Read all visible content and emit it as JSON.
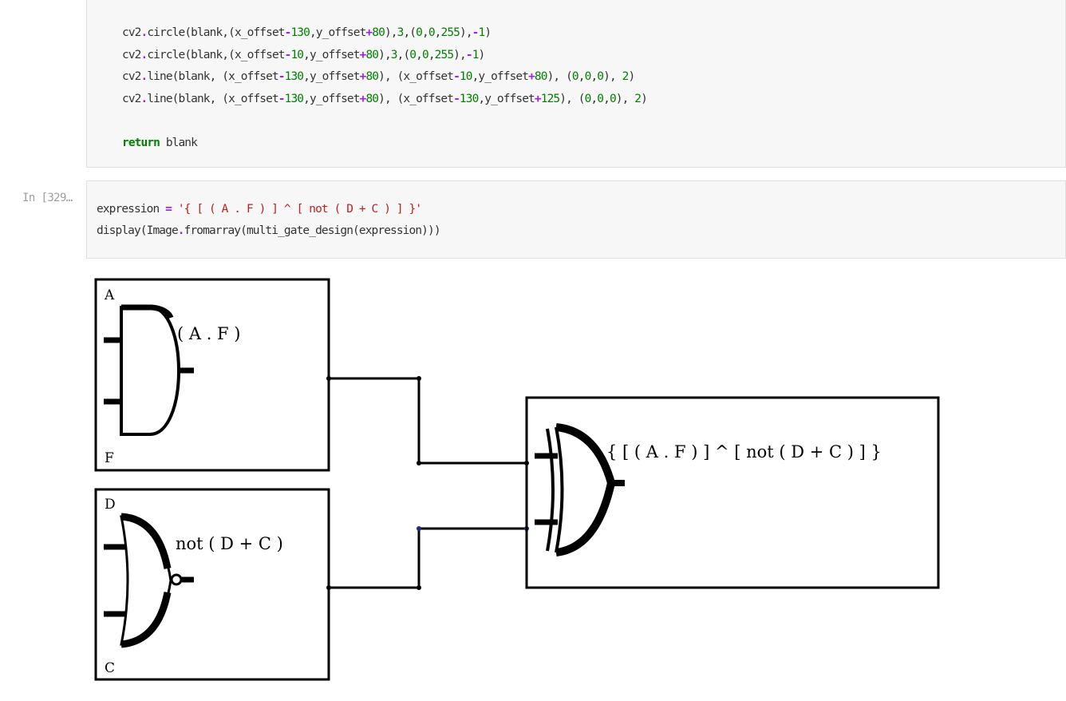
{
  "cell1": {
    "lines": [
      [
        {
          "t": "cv2",
          "c": ""
        },
        {
          "t": ".",
          "c": "o"
        },
        {
          "t": "circle(blank,(x_offset",
          "c": ""
        },
        {
          "t": "-",
          "c": "o"
        },
        {
          "t": "130",
          "c": "n"
        },
        {
          "t": ",y_offset",
          "c": ""
        },
        {
          "t": "+",
          "c": "o"
        },
        {
          "t": "80",
          "c": "n"
        },
        {
          "t": "),",
          "c": ""
        },
        {
          "t": "3",
          "c": "n"
        },
        {
          "t": ",(",
          "c": ""
        },
        {
          "t": "0",
          "c": "n"
        },
        {
          "t": ",",
          "c": ""
        },
        {
          "t": "0",
          "c": "n"
        },
        {
          "t": ",",
          "c": ""
        },
        {
          "t": "255",
          "c": "n"
        },
        {
          "t": "),",
          "c": ""
        },
        {
          "t": "-",
          "c": "o"
        },
        {
          "t": "1",
          "c": "n"
        },
        {
          "t": ")",
          "c": ""
        }
      ],
      [
        {
          "t": "cv2",
          "c": ""
        },
        {
          "t": ".",
          "c": "o"
        },
        {
          "t": "circle(blank,(x_offset",
          "c": ""
        },
        {
          "t": "-",
          "c": "o"
        },
        {
          "t": "10",
          "c": "n"
        },
        {
          "t": ",y_offset",
          "c": ""
        },
        {
          "t": "+",
          "c": "o"
        },
        {
          "t": "80",
          "c": "n"
        },
        {
          "t": "),",
          "c": ""
        },
        {
          "t": "3",
          "c": "n"
        },
        {
          "t": ",(",
          "c": ""
        },
        {
          "t": "0",
          "c": "n"
        },
        {
          "t": ",",
          "c": ""
        },
        {
          "t": "0",
          "c": "n"
        },
        {
          "t": ",",
          "c": ""
        },
        {
          "t": "255",
          "c": "n"
        },
        {
          "t": "),",
          "c": ""
        },
        {
          "t": "-",
          "c": "o"
        },
        {
          "t": "1",
          "c": "n"
        },
        {
          "t": ")",
          "c": ""
        }
      ],
      [
        {
          "t": "cv2",
          "c": ""
        },
        {
          "t": ".",
          "c": "o"
        },
        {
          "t": "line(blank, (x_offset",
          "c": ""
        },
        {
          "t": "-",
          "c": "o"
        },
        {
          "t": "130",
          "c": "n"
        },
        {
          "t": ",y_offset",
          "c": ""
        },
        {
          "t": "+",
          "c": "o"
        },
        {
          "t": "80",
          "c": "n"
        },
        {
          "t": "), (x_offset",
          "c": ""
        },
        {
          "t": "-",
          "c": "o"
        },
        {
          "t": "10",
          "c": "n"
        },
        {
          "t": ",y_offset",
          "c": ""
        },
        {
          "t": "+",
          "c": "o"
        },
        {
          "t": "80",
          "c": "n"
        },
        {
          "t": "), (",
          "c": ""
        },
        {
          "t": "0",
          "c": "n"
        },
        {
          "t": ",",
          "c": ""
        },
        {
          "t": "0",
          "c": "n"
        },
        {
          "t": ",",
          "c": ""
        },
        {
          "t": "0",
          "c": "n"
        },
        {
          "t": "), ",
          "c": ""
        },
        {
          "t": "2",
          "c": "n"
        },
        {
          "t": ")",
          "c": ""
        }
      ],
      [
        {
          "t": "cv2",
          "c": ""
        },
        {
          "t": ".",
          "c": "o"
        },
        {
          "t": "line(blank, (x_offset",
          "c": ""
        },
        {
          "t": "-",
          "c": "o"
        },
        {
          "t": "130",
          "c": "n"
        },
        {
          "t": ",y_offset",
          "c": ""
        },
        {
          "t": "+",
          "c": "o"
        },
        {
          "t": "80",
          "c": "n"
        },
        {
          "t": "), (x_offset",
          "c": ""
        },
        {
          "t": "-",
          "c": "o"
        },
        {
          "t": "130",
          "c": "n"
        },
        {
          "t": ",y_offset",
          "c": ""
        },
        {
          "t": "+",
          "c": "o"
        },
        {
          "t": "125",
          "c": "n"
        },
        {
          "t": "), (",
          "c": ""
        },
        {
          "t": "0",
          "c": "n"
        },
        {
          "t": ",",
          "c": ""
        },
        {
          "t": "0",
          "c": "n"
        },
        {
          "t": ",",
          "c": ""
        },
        {
          "t": "0",
          "c": "n"
        },
        {
          "t": "), ",
          "c": ""
        },
        {
          "t": "2",
          "c": "n"
        },
        {
          "t": ")",
          "c": ""
        }
      ],
      [],
      [
        {
          "t": "return",
          "c": "k"
        },
        {
          "t": " blank",
          "c": ""
        }
      ]
    ]
  },
  "cell2": {
    "prompt": "In [329…",
    "lines": [
      [
        {
          "t": "expression ",
          "c": ""
        },
        {
          "t": "=",
          "c": "o"
        },
        {
          "t": " ",
          "c": ""
        },
        {
          "t": "'{ [ ( A . F ) ] ^ [ not ( D + C ) ] }'",
          "c": "s"
        }
      ],
      [
        {
          "t": "display(Image",
          "c": ""
        },
        {
          "t": ".",
          "c": "o"
        },
        {
          "t": "fromarray(multi_gate_design(expression)))",
          "c": ""
        }
      ]
    ]
  },
  "diagram": {
    "input_a": "A",
    "input_f": "F",
    "input_d": "D",
    "input_c": "C",
    "and_output": "( A . F )",
    "nor_output": "not ( D + C )",
    "xor_output": "{ [ ( A . F ) ] ^ [ not ( D + C ) ] }"
  },
  "colors": {
    "cell_bg": "#f7f7f7",
    "keyword": "#008000",
    "number": "#008000",
    "operator": "#a020f0",
    "string": "#ba2121",
    "prompt": "#9e9e9e",
    "junction_blue": "#1f2a8c"
  }
}
